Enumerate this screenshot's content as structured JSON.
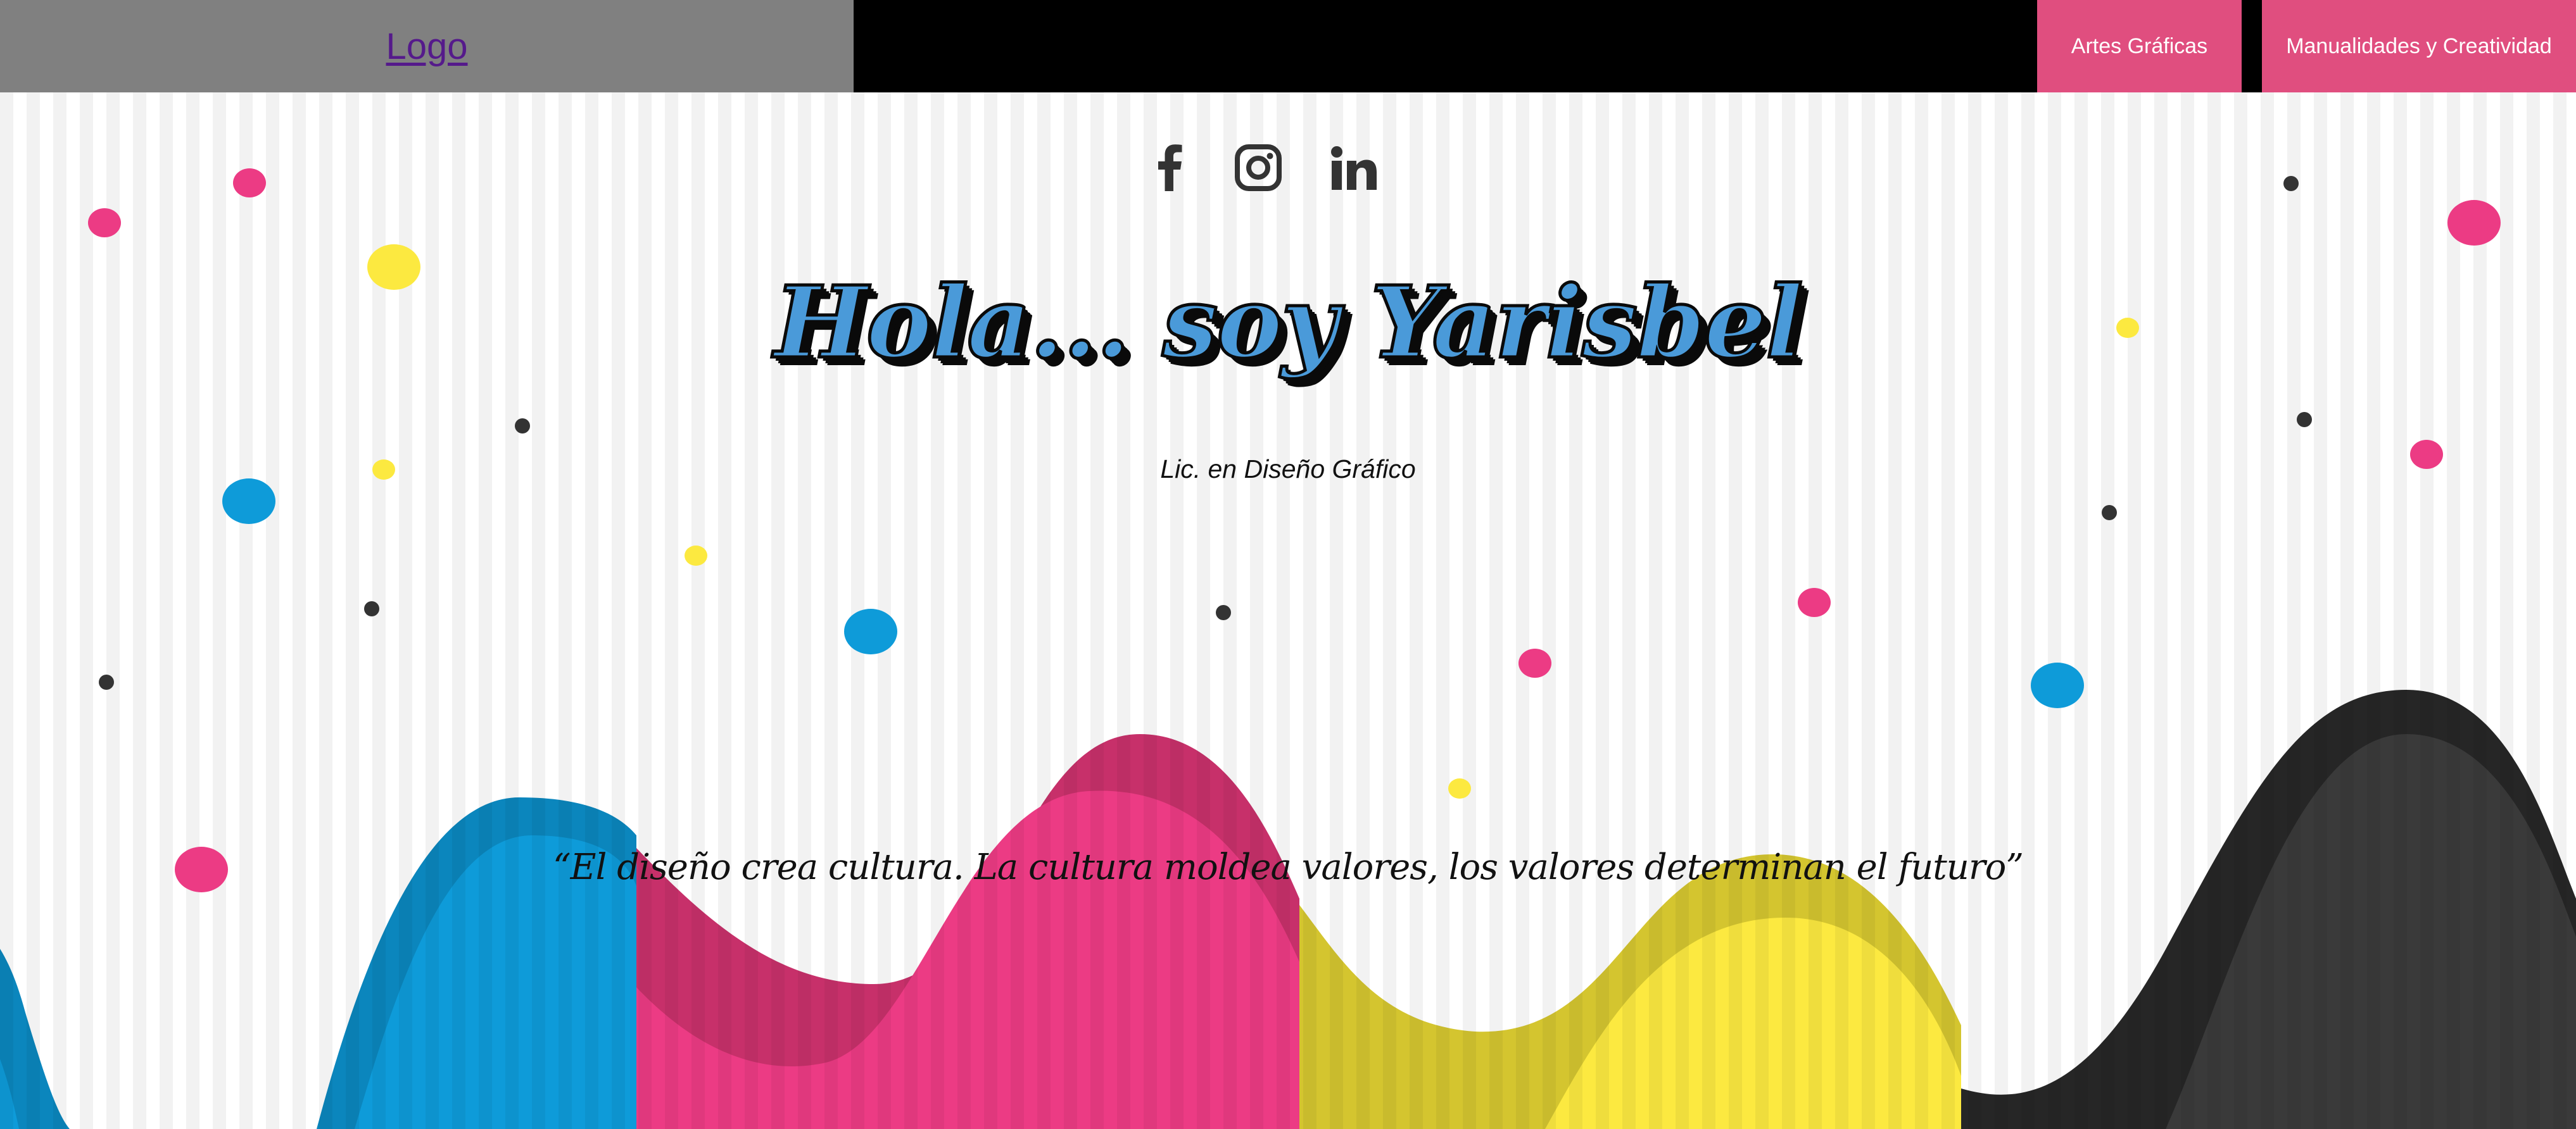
{
  "header": {
    "logo_label": "Logo",
    "nav": [
      {
        "label": "Artes Gráficas"
      },
      {
        "label": "Manualidades y Creatividad"
      }
    ]
  },
  "social": {
    "icons": [
      "facebook-icon",
      "instagram-icon",
      "linkedin-icon"
    ]
  },
  "hero": {
    "title": "Hola... soy Yarisbel",
    "subtitle": "Lic. en Diseño Gráfico",
    "quote": "“El diseño crea cultura. La cultura moldea valores, los valores determinan el futuro”"
  },
  "colors": {
    "nav_bg": "#000000",
    "logo_bg": "#808080",
    "nav_button": "#e04e7f",
    "accent_blue": "#4a9ad9",
    "cyan": "#0e9bd9",
    "magenta": "#ec3b84",
    "yellow": "#fce940",
    "black": "#2e2e2e"
  }
}
